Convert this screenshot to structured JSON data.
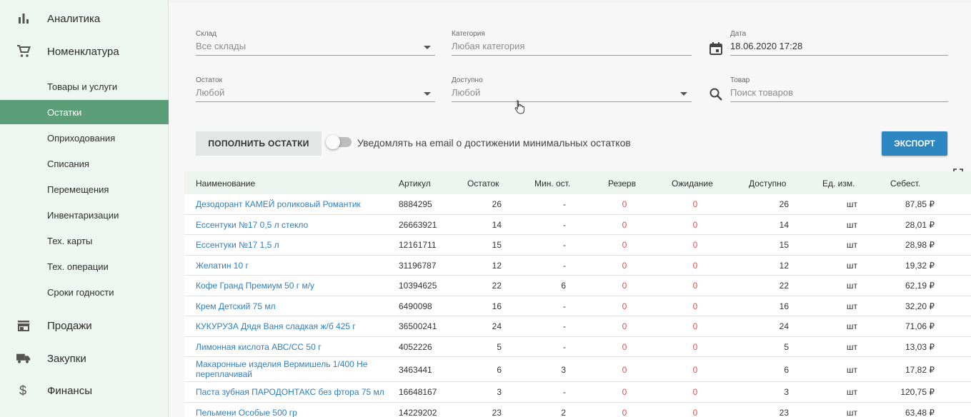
{
  "sidebar": {
    "top_items": [
      {
        "label": "Аналитика",
        "icon": "bar-chart-icon"
      },
      {
        "label": "Номенклатура",
        "icon": "cart-icon"
      }
    ],
    "sub_items": [
      {
        "label": "Товары и услуги"
      },
      {
        "label": "Остатки",
        "active": true
      },
      {
        "label": "Оприходования"
      },
      {
        "label": "Списания"
      },
      {
        "label": "Перемещения"
      },
      {
        "label": "Инвентаризации"
      },
      {
        "label": "Тех. карты"
      },
      {
        "label": "Тех. операции"
      },
      {
        "label": "Сроки годности"
      }
    ],
    "bottom_items": [
      {
        "label": "Продажи",
        "icon": "store-icon"
      },
      {
        "label": "Закупки",
        "icon": "truck-icon"
      },
      {
        "label": "Финансы",
        "icon": "dollar-icon"
      }
    ]
  },
  "filters": {
    "warehouse": {
      "label": "Склад",
      "value": "Все склады"
    },
    "category": {
      "label": "Категория",
      "placeholder": "Любая категория"
    },
    "date": {
      "label": "Дата",
      "value": "18.06.2020 17:28"
    },
    "stock": {
      "label": "Остаток",
      "value": "Любой"
    },
    "available": {
      "label": "Доступно",
      "value": "Любой"
    },
    "product": {
      "label": "Товар",
      "placeholder": "Поиск товаров"
    }
  },
  "actions": {
    "replenish_label": "ПОПОЛНИТЬ ОСТАТКИ",
    "notify_label": "Уведомлять на email о достижении минимальных остатков",
    "notify_on": false,
    "export_label": "ЭКСПОРТ"
  },
  "colors": {
    "accent": "#5c9e78",
    "link": "#2f7fc1",
    "export": "#2e86c1",
    "zero": "#e35050"
  },
  "table": {
    "columns": [
      "Наименование",
      "Артикул",
      "Остаток",
      "Мин. ост.",
      "Резерв",
      "Ожидание",
      "Доступно",
      "Ед. изм.",
      "Себест."
    ],
    "rows": [
      {
        "name": "Дезодорант КАМЕЙ роликовый Романтик",
        "sku": "8884295",
        "stock": "26",
        "min": "-",
        "reserve": "0",
        "waiting": "0",
        "available": "26",
        "unit": "шт",
        "cost": "87,85 ₽"
      },
      {
        "name": "Ессентуки №17 0,5 л стекло",
        "sku": "26663921",
        "stock": "14",
        "min": "-",
        "reserve": "0",
        "waiting": "0",
        "available": "14",
        "unit": "шт",
        "cost": "28,01 ₽"
      },
      {
        "name": "Ессентуки №17 1,5 л",
        "sku": "12161711",
        "stock": "15",
        "min": "-",
        "reserve": "0",
        "waiting": "0",
        "available": "15",
        "unit": "шт",
        "cost": "28,98 ₽"
      },
      {
        "name": "Желатин 10 г",
        "sku": "31196787",
        "stock": "12",
        "min": "-",
        "reserve": "0",
        "waiting": "0",
        "available": "12",
        "unit": "шт",
        "cost": "19,32 ₽"
      },
      {
        "name": "Кофе Гранд Премиум 50 г м/у",
        "sku": "10394625",
        "stock": "22",
        "min": "6",
        "reserve": "0",
        "waiting": "0",
        "available": "22",
        "unit": "шт",
        "cost": "62,19 ₽"
      },
      {
        "name": "Крем Детский 75 мл",
        "sku": "6490098",
        "stock": "16",
        "min": "-",
        "reserve": "0",
        "waiting": "0",
        "available": "16",
        "unit": "шт",
        "cost": "32,20 ₽"
      },
      {
        "name": "КУКУРУЗА Дядя Ваня сладкая ж/б 425 г",
        "sku": "36500241",
        "stock": "24",
        "min": "-",
        "reserve": "0",
        "waiting": "0",
        "available": "24",
        "unit": "шт",
        "cost": "71,06 ₽"
      },
      {
        "name": "Лимонная кислота АВС/СС 50 г",
        "sku": "4052226",
        "stock": "5",
        "min": "-",
        "reserve": "0",
        "waiting": "0",
        "available": "5",
        "unit": "шт",
        "cost": "13,03 ₽"
      },
      {
        "name": "Макаронные изделия Вермишель 1/400 Не переплачивай",
        "sku": "3463441",
        "stock": "6",
        "min": "3",
        "reserve": "0",
        "waiting": "0",
        "available": "6",
        "unit": "шт",
        "cost": "17,82 ₽"
      },
      {
        "name": "Паста зубная ПАРОДОНТАКС без фтора 75 мл",
        "sku": "16648167",
        "stock": "3",
        "min": "-",
        "reserve": "0",
        "waiting": "0",
        "available": "3",
        "unit": "шт",
        "cost": "120,75 ₽"
      },
      {
        "name": "Пельмени Особые 500 гр",
        "sku": "14229202",
        "stock": "23",
        "min": "2",
        "reserve": "0",
        "waiting": "0",
        "available": "23",
        "unit": "шт",
        "cost": "63,48 ₽"
      }
    ]
  }
}
